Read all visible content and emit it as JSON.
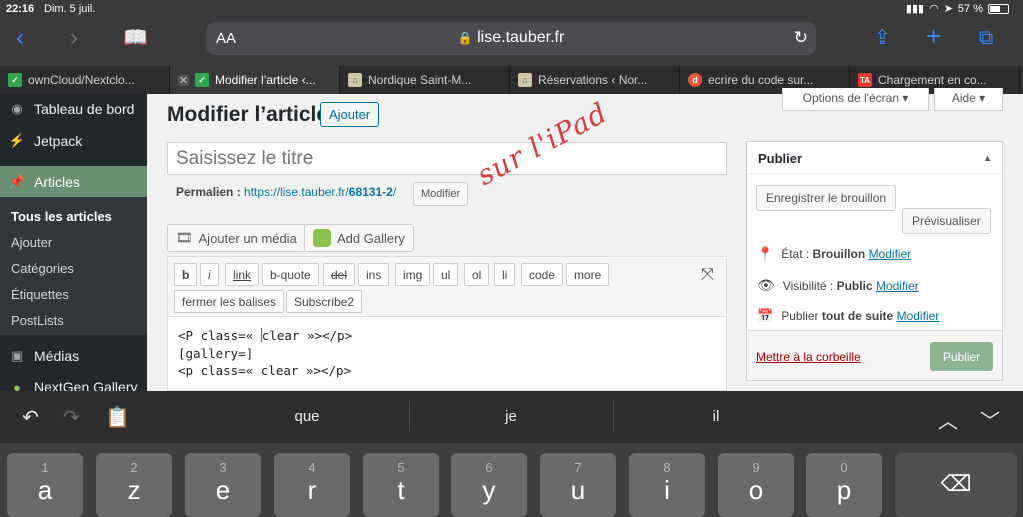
{
  "status": {
    "time": "22:16",
    "date": "Dim. 5 juil.",
    "battery": "57 %"
  },
  "safari": {
    "aa": "AA",
    "url": "lise.tauber.fr"
  },
  "tabs": [
    {
      "title": "ownCloud/Nextclo...",
      "favicon_color": "#2fa84f",
      "favicon": "✓"
    },
    {
      "title": "Modifier l’article ‹...",
      "favicon_color": "#2fa84f",
      "favicon": "✓"
    },
    {
      "title": "Nordique Saint-M...",
      "favicon_color": "#cfc7a8",
      "favicon": "⌂"
    },
    {
      "title": "Réservations ‹ Nor...",
      "favicon_color": "#cfc7a8",
      "favicon": "⌂"
    },
    {
      "title": "ecrire du code sur...",
      "favicon_color": "#de5833",
      "favicon": "d"
    },
    {
      "title": "Chargement en co...",
      "favicon_color": "#e23b2d",
      "favicon": "TA"
    }
  ],
  "sidebar": {
    "items": [
      {
        "label": "Tableau de bord",
        "icon": "dashboard-icon"
      },
      {
        "label": "Jetpack",
        "icon": "jetpack-icon"
      },
      {
        "label": "Articles",
        "icon": "pin-icon"
      }
    ],
    "submenu": [
      "Tous les articles",
      "Ajouter",
      "Catégories",
      "Étiquettes",
      "PostLists"
    ],
    "bottom": [
      {
        "label": "Médias",
        "icon": "media-icon"
      },
      {
        "label": "NextGen Gallery",
        "icon": "gallery-icon"
      }
    ]
  },
  "header": {
    "title": "Modifier l’article",
    "add_label": "Ajouter",
    "screen_options": "Options de l'écran ▾",
    "help": "Aide ▾"
  },
  "editor": {
    "title_placeholder": "Saisissez le titre",
    "permalink_label": "Permalien :",
    "permalink_url_prefix": "https://lise.tauber.fr/",
    "permalink_slug": "68131-2",
    "permalink_url_suffix": "/",
    "permalink_edit": "Modifier",
    "handwriting": "sur l'iPad",
    "add_media": "Ajouter un média",
    "add_gallery": "Add Gallery",
    "quicktags": [
      "b",
      "i",
      "link",
      "b-quote",
      "del",
      "ins",
      "img",
      "ul",
      "ol",
      "li",
      "code",
      "more"
    ],
    "quicktags_row2": [
      "fermer les balises",
      "Subscribe2"
    ],
    "code_line1_a": "<P class=« ",
    "code_line1_b": "clear »></p>",
    "code_line2": "[gallery=]",
    "code_line3": "<p class=« clear »></p>"
  },
  "publish": {
    "heading": "Publier",
    "save_draft": "Enregistrer le brouillon",
    "preview": "Prévisualiser",
    "status_label": "État :",
    "status_value": "Brouillon",
    "visibility_label": "Visibilité :",
    "visibility_value": "Public",
    "schedule_label": "Publier",
    "schedule_value": "tout de suite",
    "edit": "Modifier",
    "trash": "Mettre à la corbeille",
    "publish": "Publier"
  },
  "keyboard": {
    "suggestions": [
      "que",
      "je",
      "il"
    ],
    "keys": [
      {
        "num": "1",
        "letter": "a"
      },
      {
        "num": "2",
        "letter": "z"
      },
      {
        "num": "3",
        "letter": "e"
      },
      {
        "num": "4",
        "letter": "r"
      },
      {
        "num": "5",
        "letter": "t"
      },
      {
        "num": "6",
        "letter": "y"
      },
      {
        "num": "7",
        "letter": "u"
      },
      {
        "num": "8",
        "letter": "i"
      },
      {
        "num": "9",
        "letter": "o"
      },
      {
        "num": "0",
        "letter": "p"
      }
    ]
  }
}
